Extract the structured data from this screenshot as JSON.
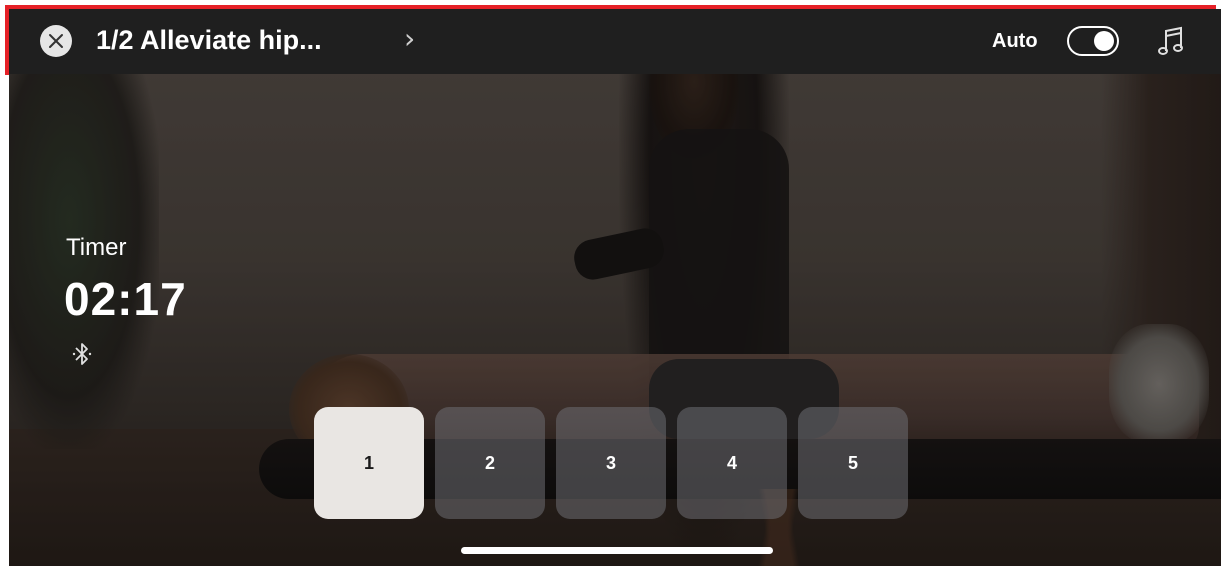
{
  "header": {
    "close_icon": "close-icon",
    "title": "1/2 Alleviate hip...",
    "title_chevron": "›",
    "auto_label": "Auto",
    "auto_enabled": true,
    "music_icon": "music-note-icon"
  },
  "timer": {
    "label": "Timer",
    "value": "02:17",
    "bluetooth_icon": "bluetooth-icon"
  },
  "steps": {
    "items": [
      {
        "label": "1",
        "active": true
      },
      {
        "label": "2",
        "active": false
      },
      {
        "label": "3",
        "active": false
      },
      {
        "label": "4",
        "active": false
      },
      {
        "label": "5",
        "active": false
      }
    ]
  },
  "colors": {
    "highlight": "#e52027",
    "header_bg": "#1f1f1f",
    "active_step_bg": "#e9e6e3"
  }
}
